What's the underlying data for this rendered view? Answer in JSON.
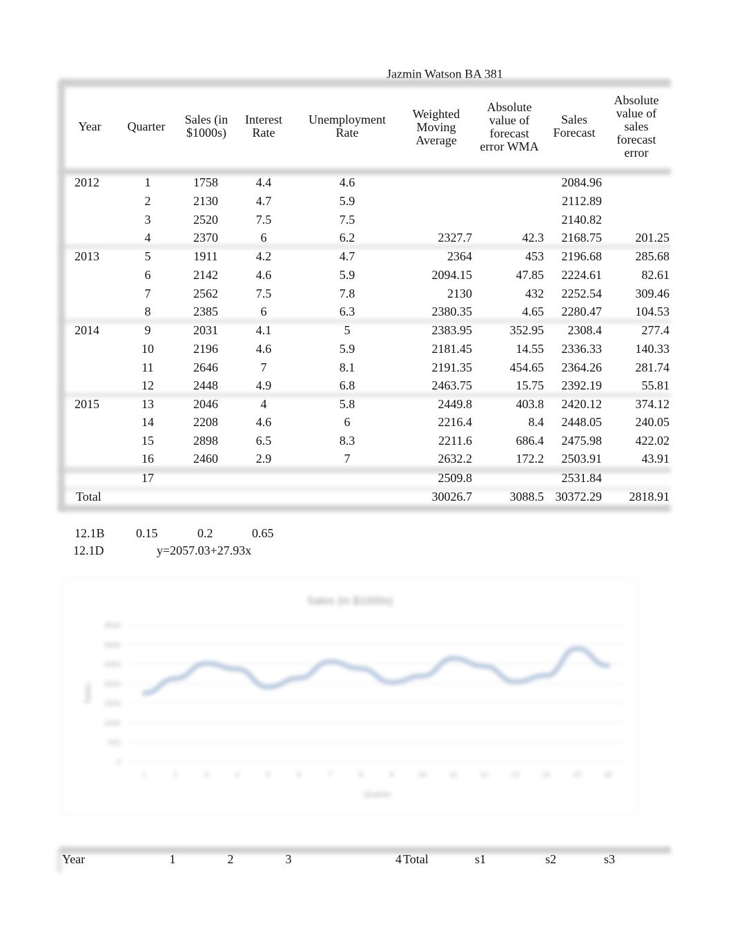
{
  "document": {
    "author_line": "Jazmin Watson BA 381"
  },
  "table": {
    "headers": {
      "year": "Year",
      "quarter": "Quarter",
      "sales_l1": "Sales (in",
      "sales_l2": "$1000s)",
      "interest_l1": "Interest",
      "interest_l2": "Rate",
      "unemp_l1": "Unemployment",
      "unemp_l2": "Rate",
      "wma_l1": "Weighted",
      "wma_l2": "Moving",
      "wma_l3": "Average",
      "abswma_l1": "Absolute",
      "abswma_l2": "value of",
      "abswma_l3": "forecast",
      "abswma_l4": "error WMA",
      "sf_l1": "Sales",
      "sf_l2": "Forecast",
      "abssf_l1": "Absolute",
      "abssf_l2": "value of",
      "abssf_l3": "sales",
      "abssf_l4": "forecast",
      "abssf_l5": "error"
    },
    "rows": [
      {
        "year": "2012",
        "quarter": "1",
        "sales": "1758",
        "interest": "4.4",
        "unemployment": "4.6",
        "wma": "",
        "abs_wma": "",
        "sales_forecast": "2084.96",
        "abs_sf": ""
      },
      {
        "year": "",
        "quarter": "2",
        "sales": "2130",
        "interest": "4.7",
        "unemployment": "5.9",
        "wma": "",
        "abs_wma": "",
        "sales_forecast": "2112.89",
        "abs_sf": ""
      },
      {
        "year": "",
        "quarter": "3",
        "sales": "2520",
        "interest": "7.5",
        "unemployment": "7.5",
        "wma": "",
        "abs_wma": "",
        "sales_forecast": "2140.82",
        "abs_sf": ""
      },
      {
        "year": "",
        "quarter": "4",
        "sales": "2370",
        "interest": "6",
        "unemployment": "6.2",
        "wma": "2327.7",
        "abs_wma": "42.3",
        "sales_forecast": "2168.75",
        "abs_sf": "201.25"
      },
      {
        "year": "2013",
        "quarter": "5",
        "sales": "1911",
        "interest": "4.2",
        "unemployment": "4.7",
        "wma": "2364",
        "abs_wma": "453",
        "sales_forecast": "2196.68",
        "abs_sf": "285.68"
      },
      {
        "year": "",
        "quarter": "6",
        "sales": "2142",
        "interest": "4.6",
        "unemployment": "5.9",
        "wma": "2094.15",
        "abs_wma": "47.85",
        "sales_forecast": "2224.61",
        "abs_sf": "82.61"
      },
      {
        "year": "",
        "quarter": "7",
        "sales": "2562",
        "interest": "7.5",
        "unemployment": "7.8",
        "wma": "2130",
        "abs_wma": "432",
        "sales_forecast": "2252.54",
        "abs_sf": "309.46"
      },
      {
        "year": "",
        "quarter": "8",
        "sales": "2385",
        "interest": "6",
        "unemployment": "6.3",
        "wma": "2380.35",
        "abs_wma": "4.65",
        "sales_forecast": "2280.47",
        "abs_sf": "104.53"
      },
      {
        "year": "2014",
        "quarter": "9",
        "sales": "2031",
        "interest": "4.1",
        "unemployment": "5",
        "wma": "2383.95",
        "abs_wma": "352.95",
        "sales_forecast": "2308.4",
        "abs_sf": "277.4"
      },
      {
        "year": "",
        "quarter": "10",
        "sales": "2196",
        "interest": "4.6",
        "unemployment": "5.9",
        "wma": "2181.45",
        "abs_wma": "14.55",
        "sales_forecast": "2336.33",
        "abs_sf": "140.33"
      },
      {
        "year": "",
        "quarter": "11",
        "sales": "2646",
        "interest": "7",
        "unemployment": "8.1",
        "wma": "2191.35",
        "abs_wma": "454.65",
        "sales_forecast": "2364.26",
        "abs_sf": "281.74"
      },
      {
        "year": "",
        "quarter": "12",
        "sales": "2448",
        "interest": "4.9",
        "unemployment": "6.8",
        "wma": "2463.75",
        "abs_wma": "15.75",
        "sales_forecast": "2392.19",
        "abs_sf": "55.81"
      },
      {
        "year": "2015",
        "quarter": "13",
        "sales": "2046",
        "interest": "4",
        "unemployment": "5.8",
        "wma": "2449.8",
        "abs_wma": "403.8",
        "sales_forecast": "2420.12",
        "abs_sf": "374.12"
      },
      {
        "year": "",
        "quarter": "14",
        "sales": "2208",
        "interest": "4.6",
        "unemployment": "6",
        "wma": "2216.4",
        "abs_wma": "8.4",
        "sales_forecast": "2448.05",
        "abs_sf": "240.05"
      },
      {
        "year": "",
        "quarter": "15",
        "sales": "2898",
        "interest": "6.5",
        "unemployment": "8.3",
        "wma": "2211.6",
        "abs_wma": "686.4",
        "sales_forecast": "2475.98",
        "abs_sf": "422.02"
      },
      {
        "year": "",
        "quarter": "16",
        "sales": "2460",
        "interest": "2.9",
        "unemployment": "7",
        "wma": "2632.2",
        "abs_wma": "172.2",
        "sales_forecast": "2503.91",
        "abs_sf": "43.91"
      },
      {
        "year": "",
        "quarter": "17",
        "sales": "",
        "interest": "",
        "unemployment": "",
        "wma": "2509.8",
        "abs_wma": "",
        "sales_forecast": "2531.84",
        "abs_sf": ""
      }
    ],
    "total": {
      "label": "Total",
      "wma": "30026.7",
      "abs_wma": "3088.5",
      "sales_forecast": "30372.29",
      "abs_sf": "2818.91"
    }
  },
  "notes": {
    "b_label": "12.1B",
    "b_w1": "0.15",
    "b_w2": "0.2",
    "b_w3": "0.65",
    "d_label": "12.1D",
    "d_equation": "y=2057.03+27.93x"
  },
  "chart_data": {
    "type": "line",
    "title": "Sales (in $1000s)",
    "xlabel": "Quarter",
    "ylabel": "Sales",
    "x": [
      1,
      2,
      3,
      4,
      5,
      6,
      7,
      8,
      9,
      10,
      11,
      12,
      13,
      14,
      15,
      16
    ],
    "series": [
      {
        "name": "Sales",
        "values": [
          1758,
          2130,
          2520,
          2370,
          1911,
          2142,
          2562,
          2385,
          2031,
          2196,
          2646,
          2448,
          2046,
          2208,
          2898,
          2460
        ]
      }
    ],
    "ylim": [
      0,
      3500
    ],
    "yticks": [
      0,
      500,
      1000,
      1500,
      2000,
      2500,
      3000,
      3500
    ],
    "grid": true,
    "line_color": "#b9c9df"
  },
  "bottom_table": {
    "headers": [
      "Year",
      "1",
      "2",
      "3",
      "4",
      "Total",
      "s1",
      "s2",
      "s3"
    ]
  }
}
